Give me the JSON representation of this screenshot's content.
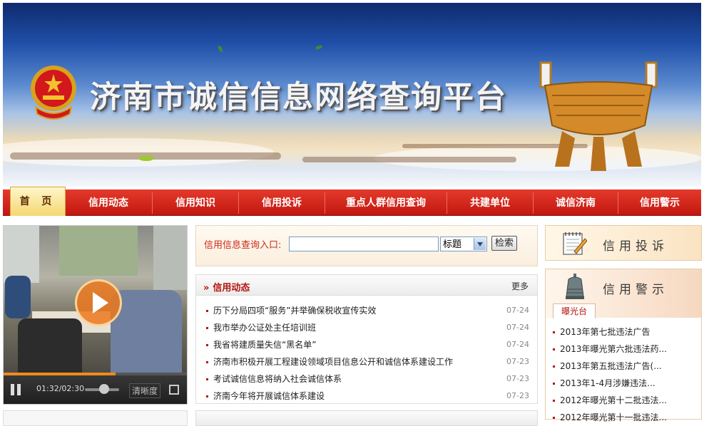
{
  "banner": {
    "title": "济南市诚信信息网络查询平台"
  },
  "nav": {
    "home": "首 页",
    "items": [
      "信用动态",
      "信用知识",
      "信用投诉",
      "重点人群信用查询",
      "共建单位",
      "诚信济南",
      "信用警示"
    ]
  },
  "video": {
    "current_time": "01:32",
    "total_time": "02:30",
    "time_separator": "/",
    "progress_fraction": 0.61,
    "quality_label": "清晰度"
  },
  "search": {
    "label": "信用信息查询入口:",
    "input_value": "",
    "select_value": "标题",
    "button_label": "检索"
  },
  "news": {
    "title": "信用动态",
    "more": "更多",
    "items": [
      {
        "text": "历下分局四项“服务”并举确保税收宣传实效",
        "date": "07-24"
      },
      {
        "text": "我市举办公证处主任培训班",
        "date": "07-24"
      },
      {
        "text": "我省将建质量失信“黑名单”",
        "date": "07-24"
      },
      {
        "text": "济南市积极开展工程建设领域项目信息公开和诚信体系建设工作",
        "date": "07-23"
      },
      {
        "text": "考试诚信信息将纳入社会诚信体系",
        "date": "07-23"
      },
      {
        "text": "济南今年将开展诚信体系建设",
        "date": "07-23"
      }
    ]
  },
  "right": {
    "complaint_title": "信用投诉",
    "warning_title": "信用警示",
    "warning_tab": "曝光台",
    "warning_items": [
      "2013年第七批违法广告",
      "2013年曝光第六批违法药...",
      "2013年第五批违法广告(...",
      "2013年1-4月涉嫌违法...",
      "2012年曝光第十二批违法...",
      "2012年曝光第十一批违法..."
    ]
  },
  "colors": {
    "brand_red": "#c2170f",
    "accent_orange": "#f08a1c"
  }
}
